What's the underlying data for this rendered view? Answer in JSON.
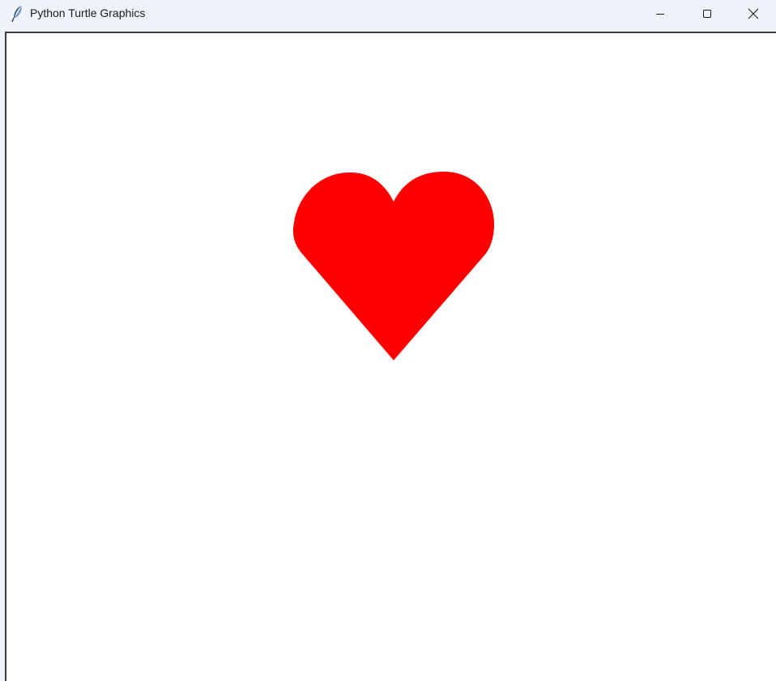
{
  "window": {
    "title": "Python Turtle Graphics",
    "app_icon": "feather-icon",
    "controls": {
      "minimize_icon": "minimize-icon",
      "maximize_icon": "maximize-icon",
      "close_icon": "close-icon"
    }
  },
  "canvas": {
    "background": "#ffffff",
    "drawing": {
      "shape": "heart",
      "fill_color": "#ff0000"
    }
  }
}
